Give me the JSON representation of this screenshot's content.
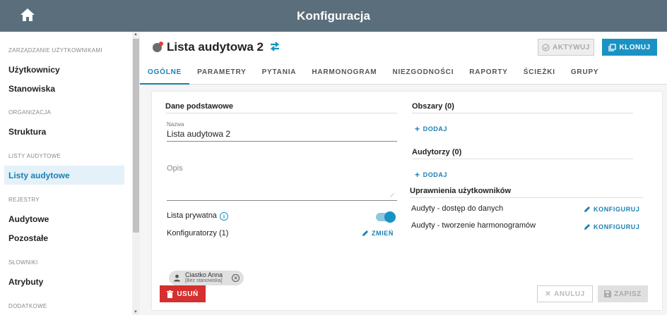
{
  "app": {
    "title": "Konfiguracja"
  },
  "sidebar": {
    "sections": [
      {
        "label": "ZARZĄDZANIE UŻYTKOWNIKAMI"
      },
      {
        "label": "ORGANIZACJA"
      },
      {
        "label": "LISTY AUDYTOWE"
      },
      {
        "label": "REJESTRY"
      },
      {
        "label": "SŁOWNIKI"
      },
      {
        "label": "DODATKOWE"
      }
    ],
    "items": [
      {
        "label": "Użytkownicy"
      },
      {
        "label": "Stanowiska"
      },
      {
        "label": "Struktura"
      },
      {
        "label": "Listy audytowe"
      },
      {
        "label": "Audytowe"
      },
      {
        "label": "Pozostałe"
      },
      {
        "label": "Atrybuty"
      }
    ]
  },
  "header": {
    "title": "Lista audytowa 2",
    "activate_label": "AKTYWUJ",
    "clone_label": "KLONUJ"
  },
  "tabs": [
    {
      "label": "OGÓLNE"
    },
    {
      "label": "PARAMETRY"
    },
    {
      "label": "PYTANIA"
    },
    {
      "label": "HARMONOGRAM"
    },
    {
      "label": "NIEZGODNOŚCI"
    },
    {
      "label": "RAPORTY"
    },
    {
      "label": "ŚCIEŻKI"
    },
    {
      "label": "GRUPY"
    }
  ],
  "basic": {
    "title": "Dane podstawowe",
    "name_label": "Nazwa",
    "name_value": "Lista audytowa 2",
    "desc_placeholder": "Opis",
    "private_label": "Lista prywatna",
    "configurators_label": "Konfiguratorzy (1)",
    "change_label": "ZMIEŃ",
    "configurator_name": "Ciastko Anna",
    "configurator_position": "[Bez stanowiska]"
  },
  "areas": {
    "title": "Obszary (0)",
    "add_label": "DODAJ"
  },
  "auditors": {
    "title": "Audytorzy (0)",
    "add_label": "DODAJ"
  },
  "permissions": {
    "title": "Uprawnienia użytkowników",
    "rows": [
      {
        "label": "Audyty - dostęp do danych",
        "action": "KONFIGURUJ"
      },
      {
        "label": "Audyty - tworzenie harmonogramów",
        "action": "KONFIGURUJ"
      }
    ]
  },
  "footer": {
    "delete_label": "USUŃ",
    "cancel_label": "ANULUJ",
    "save_label": "ZAPISZ"
  },
  "colors": {
    "accent": "#1a93c4",
    "topbar": "#5a6e7b",
    "danger": "#d62f2f"
  }
}
